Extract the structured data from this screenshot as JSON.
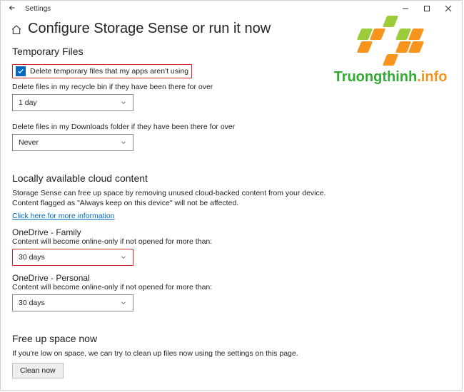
{
  "window": {
    "app_name": "Settings"
  },
  "page_title": "Configure Storage Sense or run it now",
  "temp_files": {
    "section_title": "Temporary Files",
    "checkbox_label": "Delete temporary files that my apps aren't using",
    "recycle_desc": "Delete files in my recycle bin if they have been there for over",
    "recycle_value": "1 day",
    "downloads_desc": "Delete files in my Downloads folder if they have been there for over",
    "downloads_value": "Never"
  },
  "cloud": {
    "section_title": "Locally available cloud content",
    "line1": "Storage Sense can free up space by removing unused cloud-backed content from your device.",
    "line2": "Content flagged as \"Always keep on this device\" will not be affected.",
    "link": "Click here for more information",
    "accounts": [
      {
        "title": "OneDrive - Family",
        "desc": "Content will become online-only if not opened for more than:",
        "value": "30 days",
        "highlight": true
      },
      {
        "title": "OneDrive - Personal",
        "desc": "Content will become online-only if not opened for more than:",
        "value": "30 days",
        "highlight": false
      }
    ]
  },
  "free_up": {
    "section_title": "Free up space now",
    "desc": "If you're low on space, we can try to clean up files now using the settings on this page.",
    "button": "Clean now"
  },
  "watermark": {
    "brand": "Truongthinh",
    "suffix": ".info"
  }
}
